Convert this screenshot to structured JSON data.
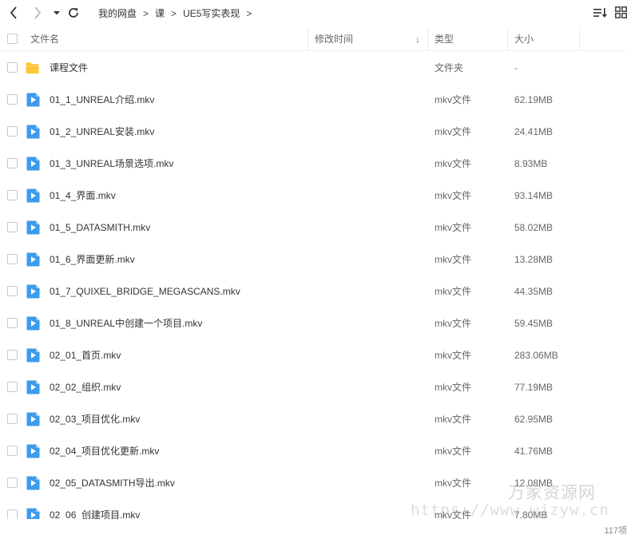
{
  "toolbar": {
    "back_icon": "chevron-left-icon",
    "forward_icon": "chevron-right-icon",
    "history_icon": "caret-down-icon",
    "refresh_icon": "refresh-icon",
    "breadcrumb": [
      "我的网盘",
      "课",
      "UE5写实表现"
    ],
    "sep": ">",
    "sort_icon": "sort-list-icon",
    "grid_icon": "grid-view-icon"
  },
  "header": {
    "name": "文件名",
    "modified": "修改时间",
    "sort_arrow": "↓",
    "type": "类型",
    "size": "大小"
  },
  "colors": {
    "folder": "#FFC637",
    "video": "#3E9BEB",
    "sort_arrow": "#2a8ae8"
  },
  "files": [
    {
      "name": "课程文件",
      "type": "文件夹",
      "size": "-",
      "icon": "folder-icon"
    },
    {
      "name": "01_1_UNREAL介绍.mkv",
      "type": "mkv文件",
      "size": "62.19MB",
      "icon": "video-file-icon"
    },
    {
      "name": "01_2_UNREAL安装.mkv",
      "type": "mkv文件",
      "size": "24.41MB",
      "icon": "video-file-icon"
    },
    {
      "name": "01_3_UNREAL场景选项.mkv",
      "type": "mkv文件",
      "size": "8.93MB",
      "icon": "video-file-icon"
    },
    {
      "name": "01_4_界面.mkv",
      "type": "mkv文件",
      "size": "93.14MB",
      "icon": "video-file-icon"
    },
    {
      "name": "01_5_DATASMITH.mkv",
      "type": "mkv文件",
      "size": "58.02MB",
      "icon": "video-file-icon"
    },
    {
      "name": "01_6_界面更新.mkv",
      "type": "mkv文件",
      "size": "13.28MB",
      "icon": "video-file-icon"
    },
    {
      "name": "01_7_QUIXEL_BRIDGE_MEGASCANS.mkv",
      "type": "mkv文件",
      "size": "44.35MB",
      "icon": "video-file-icon"
    },
    {
      "name": "01_8_UNREAL中创建一个项目.mkv",
      "type": "mkv文件",
      "size": "59.45MB",
      "icon": "video-file-icon"
    },
    {
      "name": "02_01_首页.mkv",
      "type": "mkv文件",
      "size": "283.06MB",
      "icon": "video-file-icon"
    },
    {
      "name": "02_02_组织.mkv",
      "type": "mkv文件",
      "size": "77.19MB",
      "icon": "video-file-icon"
    },
    {
      "name": "02_03_项目优化.mkv",
      "type": "mkv文件",
      "size": "62.95MB",
      "icon": "video-file-icon"
    },
    {
      "name": "02_04_项目优化更新.mkv",
      "type": "mkv文件",
      "size": "41.76MB",
      "icon": "video-file-icon"
    },
    {
      "name": "02_05_DATASMITH导出.mkv",
      "type": "mkv文件",
      "size": "12.08MB",
      "icon": "video-file-icon"
    },
    {
      "name": "02_06_创建项目.mkv",
      "type": "mkv文件",
      "size": "7.80MB",
      "icon": "video-file-icon"
    }
  ],
  "footer": {
    "count": "117项"
  },
  "watermark": {
    "line1": "万家资源网",
    "line2": "https://www.wjzyw.cn"
  }
}
